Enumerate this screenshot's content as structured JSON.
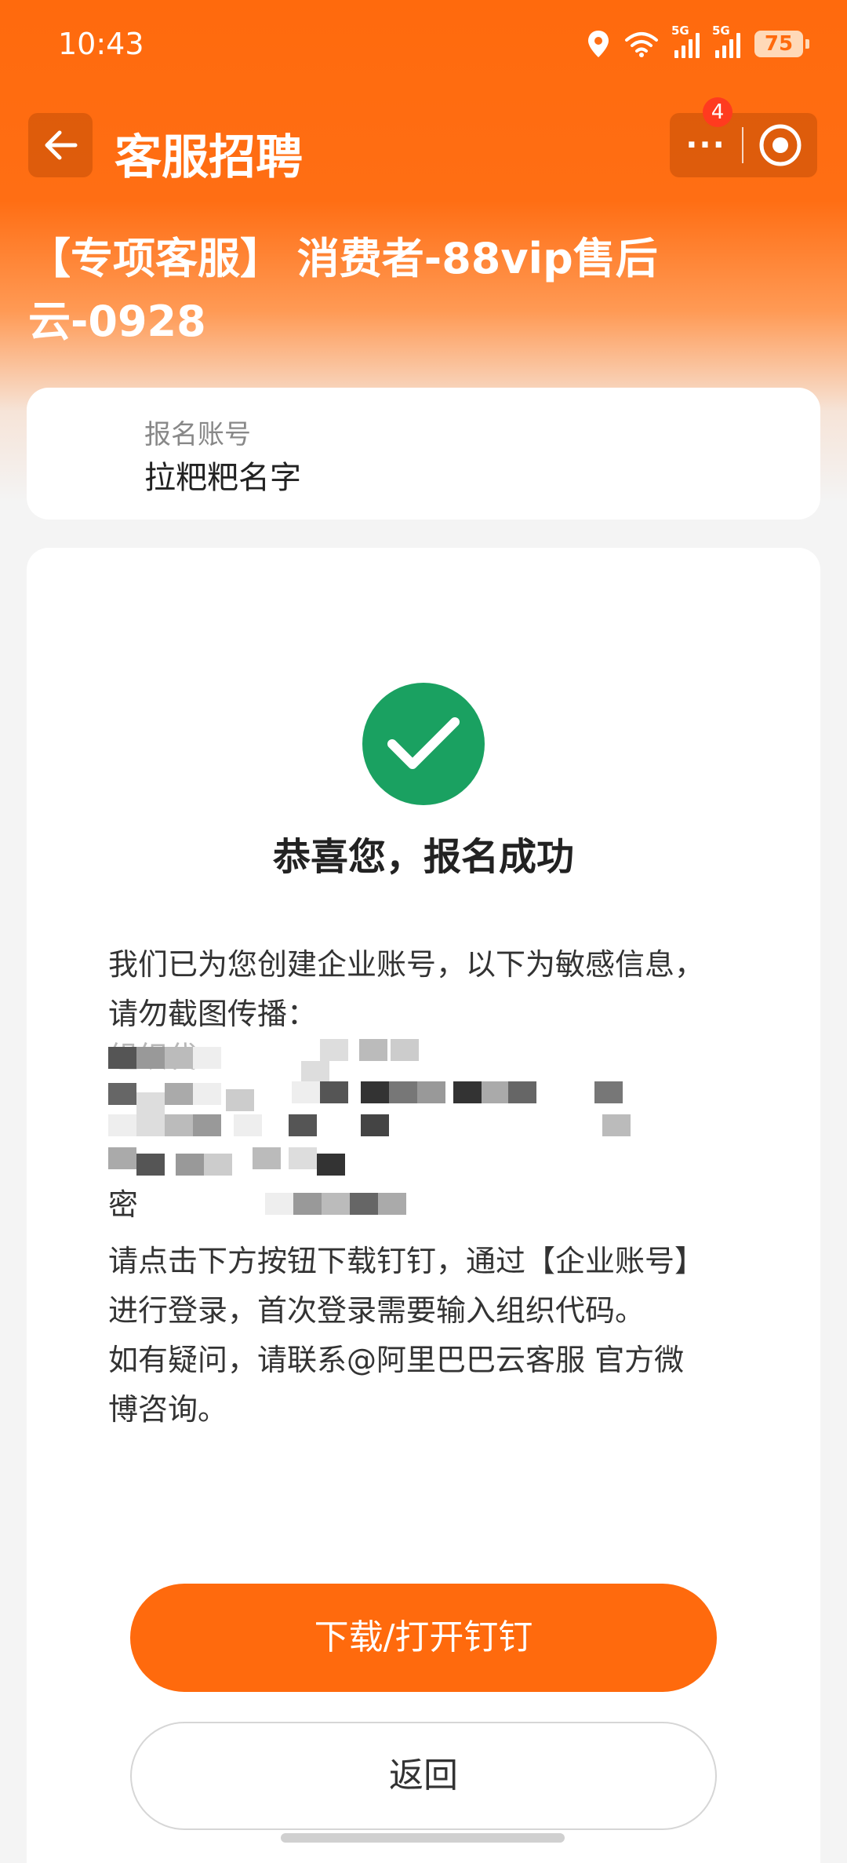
{
  "status_bar": {
    "time": "10:43",
    "signal_1_label": "5G",
    "signal_2_label": "5G",
    "battery": "75"
  },
  "nav": {
    "title": "客服招聘",
    "more_label": "···",
    "badge_count": "4",
    "back_icon": "arrow-left-icon",
    "target_icon": "target-icon"
  },
  "heading": {
    "line1": "【专项客服】 消费者-88vip售后",
    "line2": "云-0928"
  },
  "account": {
    "label": "报名账号",
    "value": "拉粑粑名字"
  },
  "result": {
    "icon": "check-icon",
    "title": "恭喜您，报名成功",
    "intro_line1": "我们已为您创建企业账号，以下为敏感信息，",
    "intro_line2": "请勿截图传播：",
    "redacted_label_1": "组织代",
    "redacted_label_4": "密",
    "instruction_line1": "请点击下方按钮下载钉钉，通过【企业账号】",
    "instruction_line2": "进行登录，首次登录需要输入组织代码。",
    "contact_line1": "如有疑问，请联系@阿里巴巴云客服 官方微",
    "contact_line2": "博咨询。"
  },
  "buttons": {
    "primary": "下载/打开钉钉",
    "secondary": "返回"
  },
  "colors": {
    "brand_orange": "#ff6a0d",
    "success_green": "#1aa161"
  }
}
